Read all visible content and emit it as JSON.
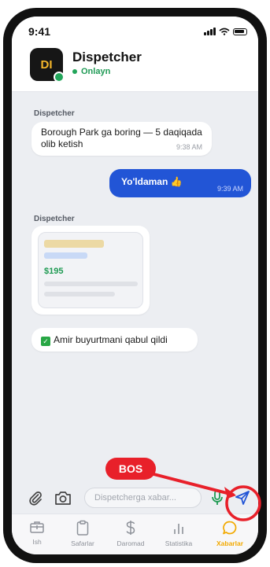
{
  "status_bar": {
    "time": "9:41"
  },
  "header": {
    "avatar_initials": "DI",
    "name": "Dispetcher",
    "status": "Onlayn"
  },
  "messages": [
    {
      "type": "incoming",
      "sender": "Dispetcher",
      "text": "Borough Park ga boring — 5 daqiqada olib ketish",
      "time": "9:38 AM"
    },
    {
      "type": "outgoing",
      "text": "Yo'ldaman 👍",
      "time": "9:39 AM"
    },
    {
      "type": "card",
      "sender": "Dispetcher",
      "price": "$195"
    },
    {
      "type": "system",
      "text": "Amir buyurtmani qabul qildi"
    }
  ],
  "composer": {
    "placeholder": "Dispetcherga xabar..."
  },
  "tabs": [
    {
      "label": "Ish",
      "icon": "briefcase-icon",
      "active": false
    },
    {
      "label": "Safarlar",
      "icon": "clipboard-icon",
      "active": false
    },
    {
      "label": "Daromad",
      "icon": "dollar-icon",
      "active": false
    },
    {
      "label": "Statistika",
      "icon": "bar-chart-icon",
      "active": false
    },
    {
      "label": "Xabarlar",
      "icon": "chat-bubble-icon",
      "active": true
    }
  ],
  "annotation": {
    "label": "BOS",
    "color": "#e8202a"
  },
  "colors": {
    "accent": "#2255d6",
    "online": "#22a55a",
    "active_tab": "#f2a900",
    "price": "#1e9a52"
  }
}
